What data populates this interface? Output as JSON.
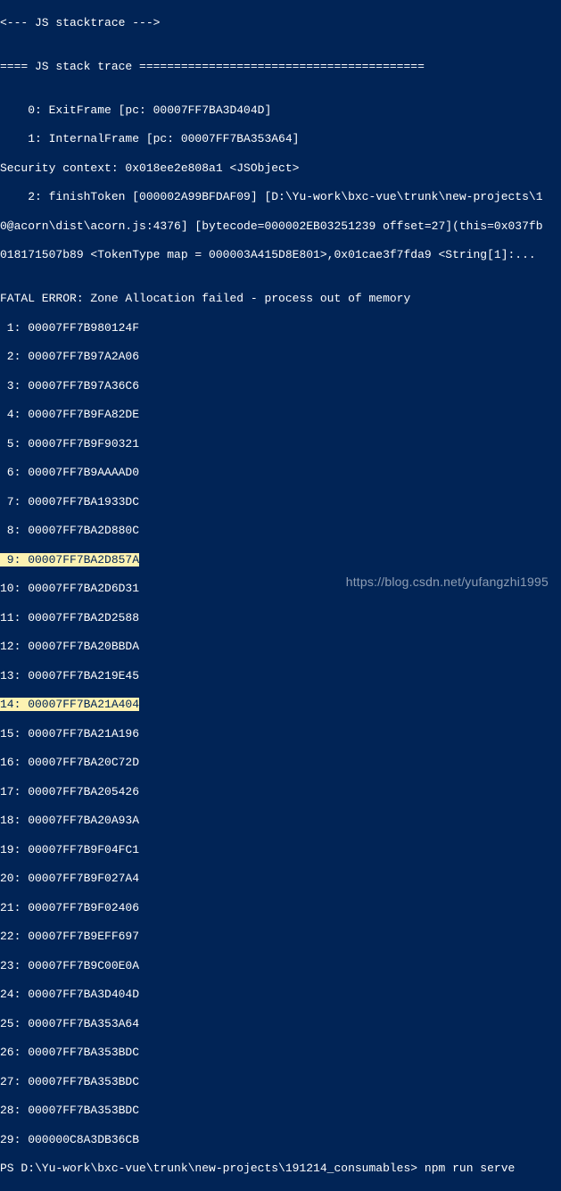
{
  "header1": "<--- JS stacktrace --->",
  "blank": "",
  "trace_header": "==== JS stack trace =========================================",
  "frame0": "    0: ExitFrame [pc: 00007FF7BA3D404D]",
  "frame1": "    1: InternalFrame [pc: 00007FF7BA353A64]",
  "security": "Security context: 0x018ee2e808a1 <JSObject>",
  "frame2": "    2: finishToken [000002A99BFDAF09] [D:\\Yu-work\\bxc-vue\\trunk\\new-projects\\1",
  "acorn": "0@acorn\\dist\\acorn.js:4376] [bytecode=000002EB03251239 offset=27](this=0x037fb",
  "tokentype": "018171507b89 <TokenType map = 000003A415D8E801>,0x01cae3f7fda9 <String[1]:...",
  "fatal": "FATAL ERROR: Zone Allocation failed - process out of memory",
  "stack": [
    " 1: 00007FF7B980124F",
    " 2: 00007FF7B97A2A06",
    " 3: 00007FF7B97A36C6",
    " 4: 00007FF7B9FA82DE",
    " 5: 00007FF7B9F90321",
    " 6: 00007FF7B9AAAAD0",
    " 7: 00007FF7BA1933DC",
    " 8: 00007FF7BA2D880C",
    " 9: 00007FF7BA2D857A",
    "10: 00007FF7BA2D6D31",
    "11: 00007FF7BA2D2588",
    "12: 00007FF7BA20BBDA",
    "13: 00007FF7BA219E45",
    "14: 00007FF7BA21A404",
    "15: 00007FF7BA21A196",
    "16: 00007FF7BA20C72D",
    "17: 00007FF7BA205426",
    "18: 00007FF7BA20A93A",
    "19: 00007FF7B9F04FC1",
    "20: 00007FF7B9F027A4",
    "21: 00007FF7B9F02406",
    "22: 00007FF7B9EFF697",
    "23: 00007FF7B9C00E0A",
    "24: 00007FF7BA3D404D",
    "25: 00007FF7BA353A64",
    "26: 00007FF7BA353BDC",
    "27: 00007FF7BA353BDC",
    "28: 00007FF7BA353BDC",
    "29: 000000C8A3DB36CB"
  ],
  "prompt": "PS D:\\Yu-work\\bxc-vue\\trunk\\new-projects\\191214_consumables> ",
  "command": "npm run serve",
  "watermark": "https://blog.csdn.net/yufangzhi1995"
}
